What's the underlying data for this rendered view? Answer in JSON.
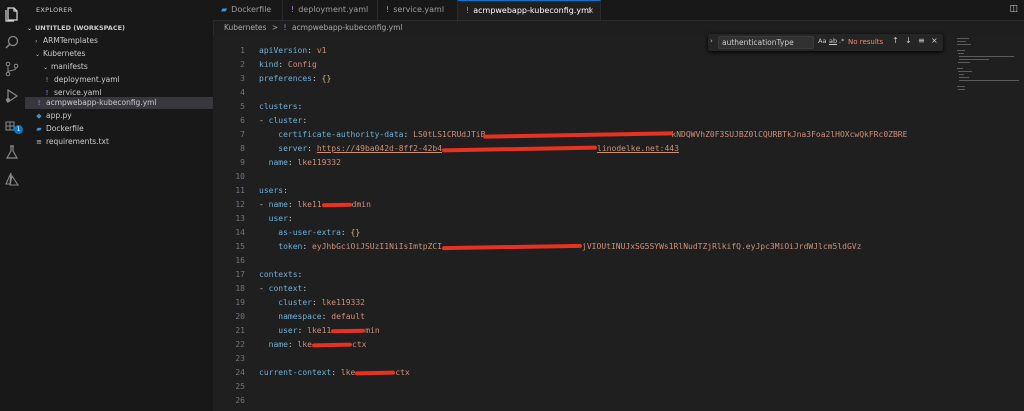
{
  "activity_bar": [
    "files-icon",
    "search-icon",
    "source-control-icon",
    "run-debug-icon",
    "extensions-icon",
    "testing-icon",
    "azure-icon"
  ],
  "extensions_badge": "1",
  "sidebar": {
    "title": "EXPLORER",
    "workspace": "UNTITLED (WORKSPACE)",
    "items": [
      {
        "label": "ARMTemplates"
      },
      {
        "label": "Kubernetes"
      },
      {
        "label": "manifests"
      },
      {
        "label": "deployment.yaml"
      },
      {
        "label": "service.yaml"
      },
      {
        "label": "acmpwebapp-kubeconfig.yml"
      },
      {
        "label": "app.py"
      },
      {
        "label": "Dockerfile"
      },
      {
        "label": "requirements.txt"
      }
    ]
  },
  "tabs": [
    {
      "label": "Dockerfile"
    },
    {
      "label": "deployment.yaml"
    },
    {
      "label": "service.yaml"
    },
    {
      "label": "acmpwebapp-kubeconfig.yml"
    }
  ],
  "tab_icon_yaml": "!",
  "tab_close": "×",
  "breadcrumb": {
    "folder": "Kubernetes",
    "sep": ">",
    "icon": "!",
    "file": "acmpwebapp-kubeconfig.yml"
  },
  "find": {
    "value": "authenticationType",
    "opt_case": "Aa",
    "opt_word": "ab",
    "opt_regex": ".*",
    "result": "No results"
  },
  "line_numbers": [
    "1",
    "2",
    "3",
    "4",
    "5",
    "6",
    "7",
    "8",
    "9",
    "10",
    "11",
    "12",
    "13",
    "14",
    "15",
    "16",
    "17",
    "18",
    "19",
    "20",
    "21",
    "22",
    "23",
    "24",
    "25",
    "26"
  ],
  "code": {
    "l1_k": "apiVersion",
    "l1_v": "v1",
    "l2_k": "kind",
    "l2_v": "Config",
    "l3_k": "preferences",
    "l3_v": "{}",
    "l6_k": "clusters",
    "l7_k": "cluster",
    "l8_k": "certificate-authority-data",
    "l8_a": "LS0tLS1CRUdJTiB",
    "l8_b": "kNDQWVhZ0F3SUJBZ0lCQURBTkJna3Foa2lHOXcwQkFRc0ZBRE",
    "l9_k": "server",
    "l9_a": "https://49ba042d-8ff2-42b4",
    "l9_b": "linodelke.net:443",
    "l10_k": "name",
    "l10_v": "lke119332",
    "l12_k": "users",
    "l13_k": "name",
    "l13_a": "lke11",
    "l13_b": "dmin",
    "l14_k": "user",
    "l15_k": "as-user-extra",
    "l15_v": "{}",
    "l16_k": "token",
    "l16_a": "eyJhbGciOiJSUzI1NiIsImtpZCI",
    "l16_b": "jVIOUtINUJxSG5SYWs1RlNudTZjRlkifQ.eyJpc3MiOiJrdWJlcm5ldGVz",
    "l18_k": "contexts",
    "l19_k": "context",
    "l20_k": "cluster",
    "l20_v": "lke119332",
    "l21_k": "namespace",
    "l21_v": "default",
    "l22_k": "user",
    "l22_a": "lke11",
    "l22_b": "min",
    "l23_k": "name",
    "l23_a": "lke",
    "l23_b": "ctx",
    "l25_k": "current-context",
    "l25_a": "lke",
    "l25_b": "ctx"
  },
  "colors": {
    "accent": "#0078d4",
    "redaction": "#e8321f",
    "key": "#6fb1d8",
    "string": "#ce9178"
  }
}
